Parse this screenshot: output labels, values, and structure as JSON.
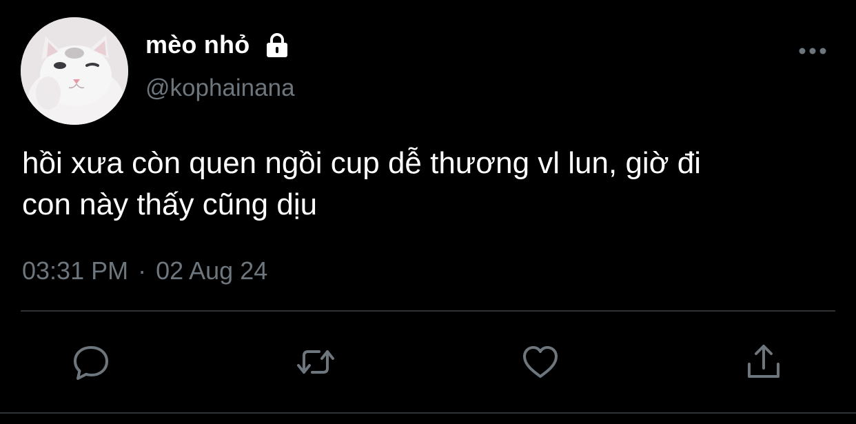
{
  "author": {
    "display_name": "mèo nhỏ",
    "handle": "@kophainana",
    "protected": true,
    "avatar_icon": "white-cat-avatar"
  },
  "tweet": {
    "text_lines": [
      "hồi xưa còn quen ngồi cup dễ thương vl lun, giờ đi",
      "con này thấy cũng dịu"
    ],
    "time": "03:31 PM",
    "separator": "·",
    "date": "02 Aug 24"
  },
  "icons": {
    "more": "more-horizontal-icon",
    "reply": "reply-icon",
    "retweet": "retweet-icon",
    "like": "heart-icon",
    "share": "share-icon",
    "lock": "lock-icon"
  },
  "colors": {
    "background": "#000000",
    "text_primary": "#ffffff",
    "text_secondary": "#6e767d",
    "divider": "#2f3336"
  }
}
